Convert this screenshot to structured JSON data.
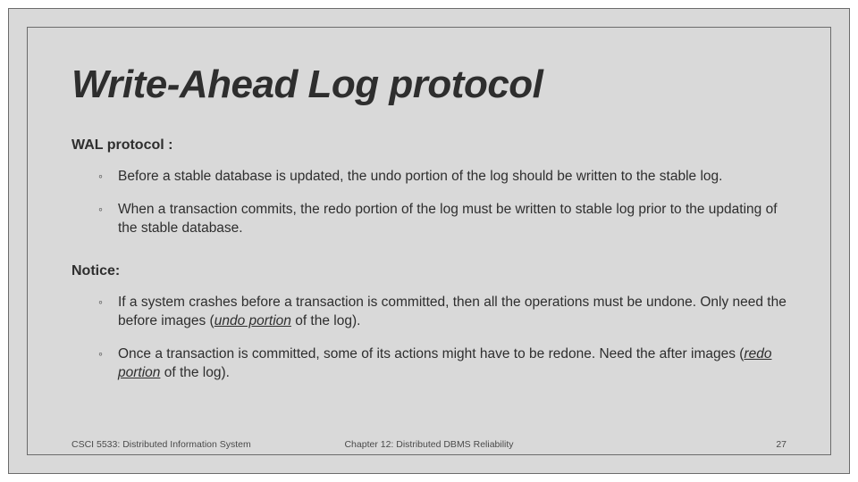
{
  "slide": {
    "title": "Write-Ahead Log protocol",
    "section1": {
      "label_prefix": "WAL protocol",
      "label_suffix": " :",
      "items": [
        "Before a stable database is updated, the undo portion of the log should be written to the stable log.",
        "When a transaction commits,  the redo portion of the log must be written to stable log prior to the updating of the stable database."
      ]
    },
    "section2": {
      "label": "Notice:",
      "item1": {
        "pre": "If a system crashes before a transaction is committed, then all the operations must be undone. Only need the before images (",
        "emph": "undo portion",
        "post": " of the log)."
      },
      "item2": {
        "pre": "Once a transaction is committed, some of its actions might have to be redone. Need the after images (",
        "emph": "redo portion",
        "post": " of the log)."
      }
    },
    "footer": {
      "left": "CSCI 5533: Distributed Information System",
      "center": "Chapter 12: Distributed DBMS Reliability",
      "right": "27"
    }
  }
}
